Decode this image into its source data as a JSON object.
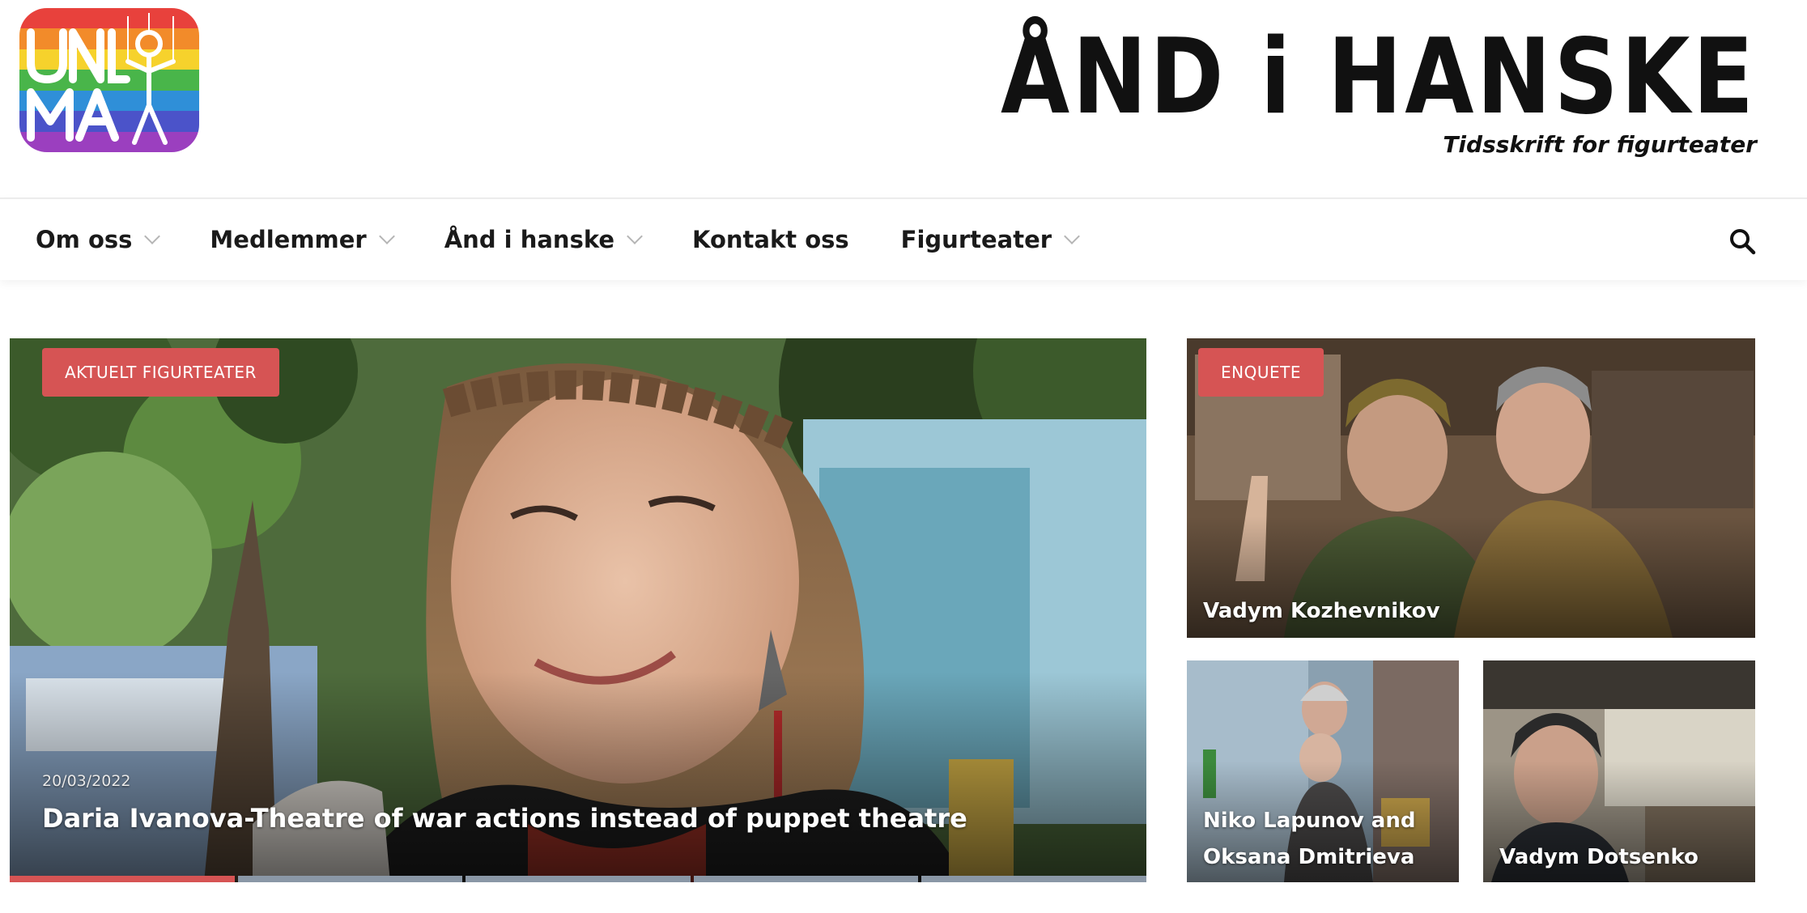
{
  "header": {
    "logo_text": "UNIMA",
    "logo_alt": "UNIMA logo",
    "brand_title": "ÅND i HANSKE",
    "brand_subtitle": "Tidsskrift for figurteater"
  },
  "nav": {
    "items": [
      {
        "label": "Om oss",
        "has_dropdown": true
      },
      {
        "label": "Medlemmer",
        "has_dropdown": true
      },
      {
        "label": "Ånd i hanske",
        "has_dropdown": true
      },
      {
        "label": "Kontakt oss",
        "has_dropdown": false
      },
      {
        "label": "Figurteater",
        "has_dropdown": true
      }
    ],
    "search_icon": "search-icon"
  },
  "hero": {
    "category": "AKTUELT FIGURTEATER",
    "date": "20/03/2022",
    "title": "Daria Ivanova-Theatre of war actions instead of puppet theatre",
    "slides": 5,
    "active_slide": 1
  },
  "cards": [
    {
      "category": "ENQUETE",
      "title": "Vadym Kozhevnikov"
    },
    {
      "category": "",
      "title": "Niko Lapunov and Oksana Dmitrieva"
    },
    {
      "category": "",
      "title": "Vadym Dotsenko"
    }
  ],
  "colors": {
    "accent": "#d65454",
    "slider_inactive": "#8a97a6",
    "text_dark": "#1a1a1a",
    "logo_stripes": [
      "#e8413c",
      "#f28b2a",
      "#f6d22c",
      "#49b54a",
      "#2f8fd8",
      "#4b53c9",
      "#9b3fbf"
    ]
  }
}
